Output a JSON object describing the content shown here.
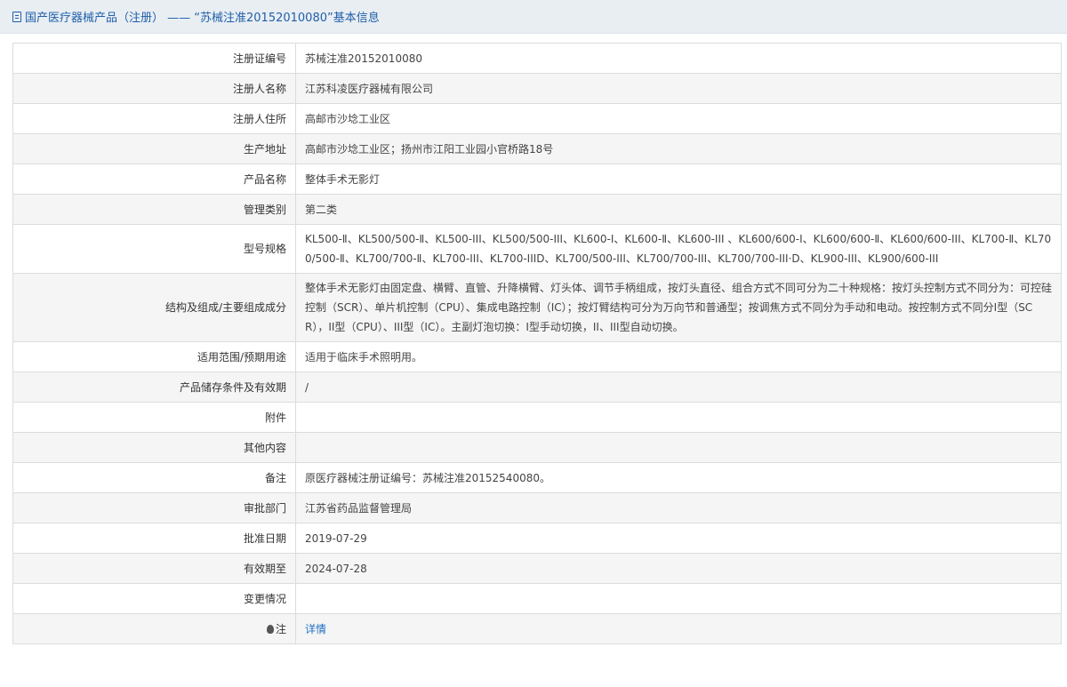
{
  "header": {
    "title": "国产医疗器械产品（注册） —— “苏械注准20152010080”基本信息",
    "icon": "document-icon"
  },
  "rows": [
    {
      "label": "注册证编号",
      "value": "苏械注准20152010080"
    },
    {
      "label": "注册人名称",
      "value": "江苏科凌医疗器械有限公司"
    },
    {
      "label": "注册人住所",
      "value": "高邮市沙埝工业区"
    },
    {
      "label": "生产地址",
      "value": "高邮市沙埝工业区；扬州市江阳工业园小官桥路18号"
    },
    {
      "label": "产品名称",
      "value": "整体手术无影灯"
    },
    {
      "label": "管理类别",
      "value": "第二类"
    },
    {
      "label": "型号规格",
      "value": "KL500-Ⅱ、KL500/500-Ⅱ、KL500-III、KL500/500-III、KL600-Ⅰ、KL600-Ⅱ、KL600-III 、KL600/600-I、KL600/600-Ⅱ、KL600/600-III、KL700-Ⅱ、KL700/500-Ⅱ、KL700/700-Ⅱ、KL700-III、KL700-IIID、KL700/500-III、KL700/700-III、KL700/700-III·D、KL900-III、KL900/600-III"
    },
    {
      "label": "结构及组成/主要组成成分",
      "value": "整体手术无影灯由固定盘、横臂、直管、升降横臂、灯头体、调节手柄组成，按灯头直径、组合方式不同可分为二十种规格：按灯头控制方式不同分为：可控硅控制（SCR）、单片机控制（CPU）、集成电路控制（IC）；按灯臂结构可分为万向节和普通型；按调焦方式不同分为手动和电动。按控制方式不同分I型（SCR），II型（CPU）、III型（IC）。主副灯泡切换：I型手动切换，II、III型自动切换。"
    },
    {
      "label": "适用范围/预期用途",
      "value": "适用于临床手术照明用。"
    },
    {
      "label": "产品储存条件及有效期",
      "value": "/"
    },
    {
      "label": "附件",
      "value": ""
    },
    {
      "label": "其他内容",
      "value": ""
    },
    {
      "label": "备注",
      "value": "原医疗器械注册证编号：苏械注准20152540080。"
    },
    {
      "label": "审批部门",
      "value": "江苏省药品监督管理局"
    },
    {
      "label": "批准日期",
      "value": "2019-07-29"
    },
    {
      "label": "有效期至",
      "value": "2024-07-28"
    },
    {
      "label": "变更情况",
      "value": ""
    }
  ],
  "note": {
    "icon": "bulb-icon",
    "label": "注",
    "link": "详情"
  }
}
